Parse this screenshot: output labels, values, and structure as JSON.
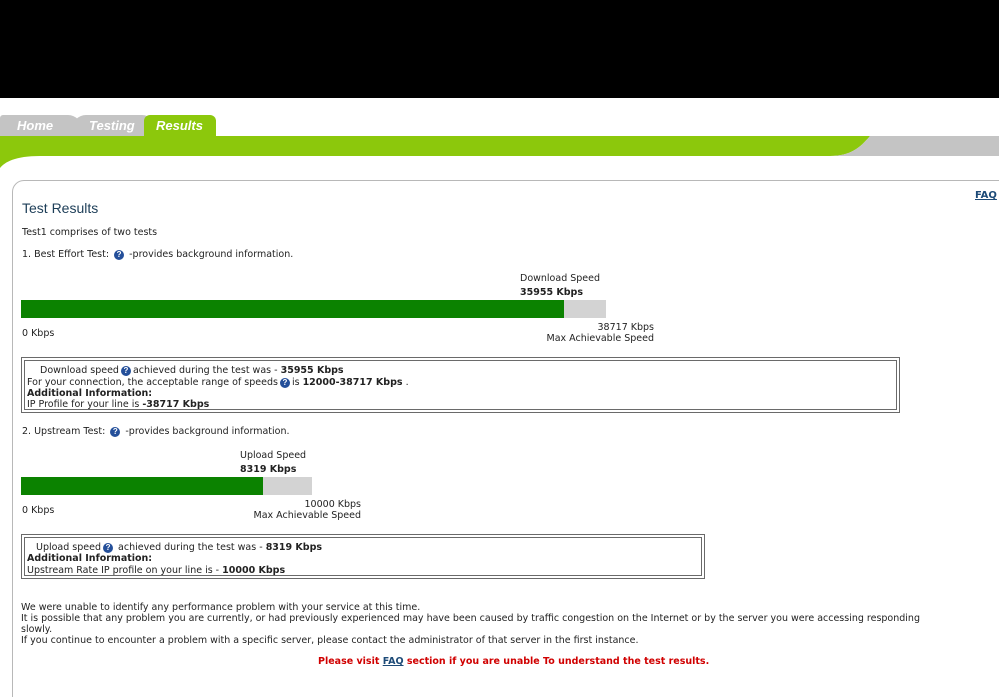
{
  "tabs": [
    {
      "label": "Home"
    },
    {
      "label": "Testing"
    },
    {
      "label": "Results"
    }
  ],
  "colors": {
    "accent_green": "#8cc80c",
    "bar_green": "#0b8200",
    "bar_track": "#d3d3d3",
    "tab_gray": "#c4c4c4",
    "warning_red": "#d00000"
  },
  "header": {
    "faq": "FAQ",
    "title": "Test Results"
  },
  "intro": "Test1 comprises of two tests",
  "best_effort": {
    "heading_before": "1. Best Effort Test:",
    "heading_after": "-provides background information.",
    "speed_label": "Download Speed",
    "speed_value": "35955 Kbps",
    "min_label": "0 Kbps",
    "max_value": "38717 Kbps",
    "max_label": "Max Achievable Speed",
    "progress_fraction": 0.9287,
    "info": {
      "line1_before": "Download speed",
      "line1_after": "achieved during the test was -",
      "line1_value": "35955 Kbps",
      "line2_before": "For your connection, the acceptable range of speeds",
      "line2_after": "is",
      "line2_value": "12000-38717 Kbps",
      "line2_end": ".",
      "line3": "Additional Information:",
      "line4_before": "IP Profile for your line is",
      "line4_value": "-38717 Kbps"
    }
  },
  "upstream": {
    "heading_before": "2. Upstream Test:",
    "heading_after": "-provides background information.",
    "speed_label": "Upload Speed",
    "speed_value": "8319 Kbps",
    "min_label": "0 Kbps",
    "max_value": "10000 Kbps",
    "max_label": "Max Achievable Speed",
    "progress_fraction": 0.8319,
    "info": {
      "line1_before": "Upload speed",
      "line1_after": "achieved during the test was -",
      "line1_value": "8319 Kbps",
      "line2": "Additional Information:",
      "line3_before": "Upstream Rate IP profile on your line is -",
      "line3_value": "10000 Kbps"
    }
  },
  "footer": {
    "line1": "We were unable to identify any performance problem with your service at this time.",
    "line2": "It is possible that any problem you are currently, or had previously experienced may have been caused by traffic congestion on the Internet or by the server you were accessing responding",
    "line3": "slowly.",
    "line4": "If you continue to encounter a problem with a specific server, please contact the administrator of that server in the first instance.",
    "notice_before": "Please visit",
    "notice_link": "FAQ",
    "notice_after": "section if you are unable To understand the test results."
  },
  "icons": {
    "help": "question-circle-icon"
  }
}
